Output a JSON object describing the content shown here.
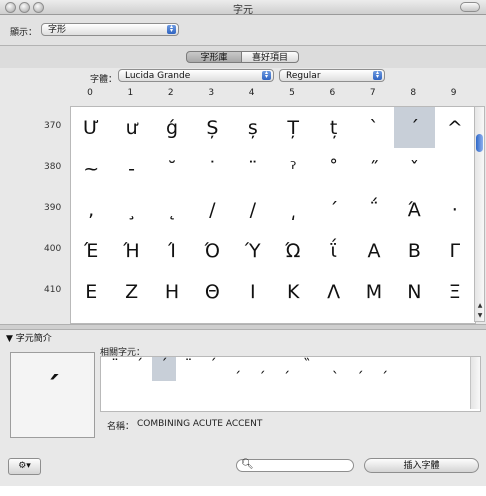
{
  "window": {
    "title": "字元"
  },
  "toolbar": {
    "view_label": "顯示：",
    "view_value": "字形"
  },
  "tabs": [
    {
      "label": "字形庫",
      "selected": true
    },
    {
      "label": "喜好項目",
      "selected": false
    }
  ],
  "font": {
    "label": "字體：",
    "family": "Lucida Grande",
    "style": "Regular"
  },
  "grid": {
    "columns": [
      "0",
      "1",
      "2",
      "3",
      "4",
      "5",
      "6",
      "7",
      "8",
      "9"
    ],
    "rows": [
      {
        "label": "370",
        "glyphs": [
          "Ư",
          "ư",
          "ǵ",
          "Ș",
          "ș",
          "Ț",
          "ț",
          "`",
          "´",
          "^"
        ]
      },
      {
        "label": "380",
        "glyphs": [
          "~",
          "-",
          "˘",
          "˙",
          "¨",
          "ˀ",
          "˚",
          "˝",
          "ˇ",
          ""
        ]
      },
      {
        "label": "390",
        "glyphs": [
          ",",
          "¸",
          "˛",
          "/",
          "/",
          "͵",
          "ˊ",
          "΅",
          "Ά",
          "·"
        ]
      },
      {
        "label": "400",
        "glyphs": [
          "Έ",
          "Ή",
          "Ί",
          "Ό",
          "Ύ",
          "Ώ",
          "ΐ",
          "Α",
          "Β",
          "Γ"
        ]
      },
      {
        "label": "410",
        "glyphs": [
          "Ε",
          "Ζ",
          "Η",
          "Θ",
          "Ι",
          "Κ",
          "Λ",
          "Μ",
          "Ν",
          "Ξ"
        ]
      }
    ],
    "selected_glyph": "´"
  },
  "info": {
    "header": "字元簡介",
    "preview_glyph": "´",
    "related_label": "相關字元：",
    "related": [
      "¨",
      "ˊ",
      "´",
      "¨",
      "ˊ",
      "ˏ",
      "ˏ",
      "ˏ",
      "̏",
      "ˎ",
      "ˏ",
      "ˏ"
    ],
    "name_label": "名稱：",
    "name_value": "COMBINING ACUTE ACCENT"
  },
  "footer": {
    "insert_label": "插入字體",
    "search_placeholder": ""
  }
}
